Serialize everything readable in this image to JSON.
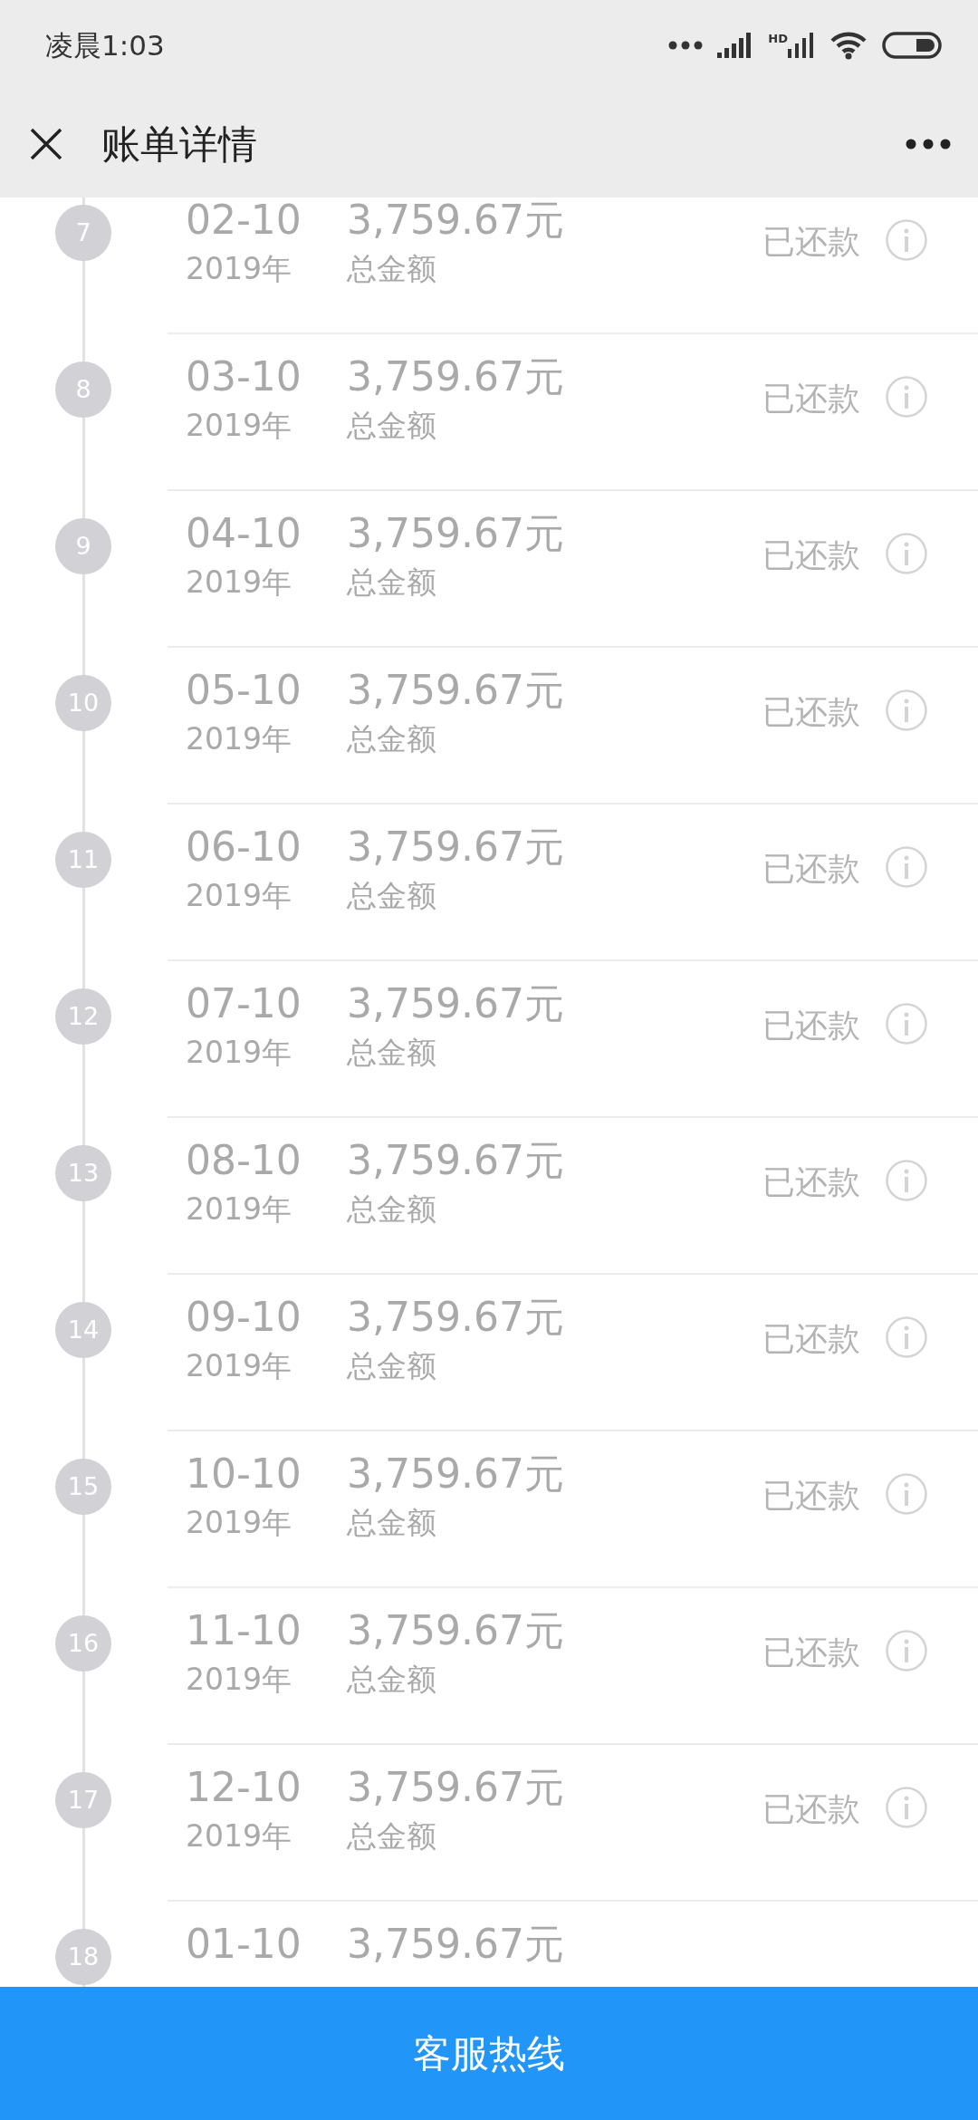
{
  "status_bar": {
    "time": "凌晨1:03",
    "network_label": "HD"
  },
  "header": {
    "title": "账单详情"
  },
  "installments": [
    {
      "number": "7",
      "date": "02-10",
      "year": "2019年",
      "amount": "3,759.67元",
      "amount_label": "总金额",
      "status": "已还款"
    },
    {
      "number": "8",
      "date": "03-10",
      "year": "2019年",
      "amount": "3,759.67元",
      "amount_label": "总金额",
      "status": "已还款"
    },
    {
      "number": "9",
      "date": "04-10",
      "year": "2019年",
      "amount": "3,759.67元",
      "amount_label": "总金额",
      "status": "已还款"
    },
    {
      "number": "10",
      "date": "05-10",
      "year": "2019年",
      "amount": "3,759.67元",
      "amount_label": "总金额",
      "status": "已还款"
    },
    {
      "number": "11",
      "date": "06-10",
      "year": "2019年",
      "amount": "3,759.67元",
      "amount_label": "总金额",
      "status": "已还款"
    },
    {
      "number": "12",
      "date": "07-10",
      "year": "2019年",
      "amount": "3,759.67元",
      "amount_label": "总金额",
      "status": "已还款"
    },
    {
      "number": "13",
      "date": "08-10",
      "year": "2019年",
      "amount": "3,759.67元",
      "amount_label": "总金额",
      "status": "已还款"
    },
    {
      "number": "14",
      "date": "09-10",
      "year": "2019年",
      "amount": "3,759.67元",
      "amount_label": "总金额",
      "status": "已还款"
    },
    {
      "number": "15",
      "date": "10-10",
      "year": "2019年",
      "amount": "3,759.67元",
      "amount_label": "总金额",
      "status": "已还款"
    },
    {
      "number": "16",
      "date": "11-10",
      "year": "2019年",
      "amount": "3,759.67元",
      "amount_label": "总金额",
      "status": "已还款"
    },
    {
      "number": "17",
      "date": "12-10",
      "year": "2019年",
      "amount": "3,759.67元",
      "amount_label": "总金额",
      "status": "已还款"
    },
    {
      "number": "18",
      "date": "01-10",
      "amount": "3,759.67元"
    }
  ],
  "footer_button": "客服热线"
}
